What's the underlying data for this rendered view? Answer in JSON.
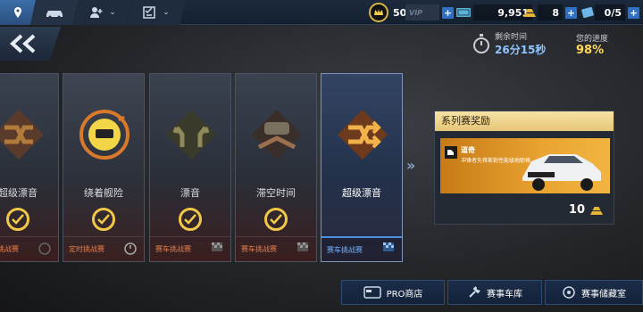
{
  "topbar": {
    "crown_value": "50",
    "vip_label": "VIP",
    "cash_value": "9,951",
    "gold_value": "8",
    "tickets_value": "0/5"
  },
  "timer": {
    "label": "剩余时间",
    "value": "26分15秒"
  },
  "progress": {
    "label": "您的进度",
    "value": "98%"
  },
  "cards": [
    {
      "name": "超级漂音",
      "footer": "赛车挑战赛"
    },
    {
      "name": "绕着舰险",
      "footer": "定时挑战赛"
    },
    {
      "name": "漂音",
      "footer": "赛车挑战赛"
    },
    {
      "name": "滞空时间",
      "footer": "赛车挑战赛"
    },
    {
      "name": "超级漂音",
      "footer": "赛车挑战赛"
    }
  ],
  "reward": {
    "title": "系列赛奖励",
    "item_name": "道奇",
    "item_desc": "冲锋者先蒋斯勒性能级地职格",
    "count": "10"
  },
  "bottom": {
    "pro_shop": "PRO商店",
    "event_garage": "赛事车库",
    "event_vault": "赛事储藏室"
  },
  "colors": {
    "accent_blue": "#2f6fc4",
    "gold": "#f2c84a",
    "reward_orange": "#e9a330"
  }
}
